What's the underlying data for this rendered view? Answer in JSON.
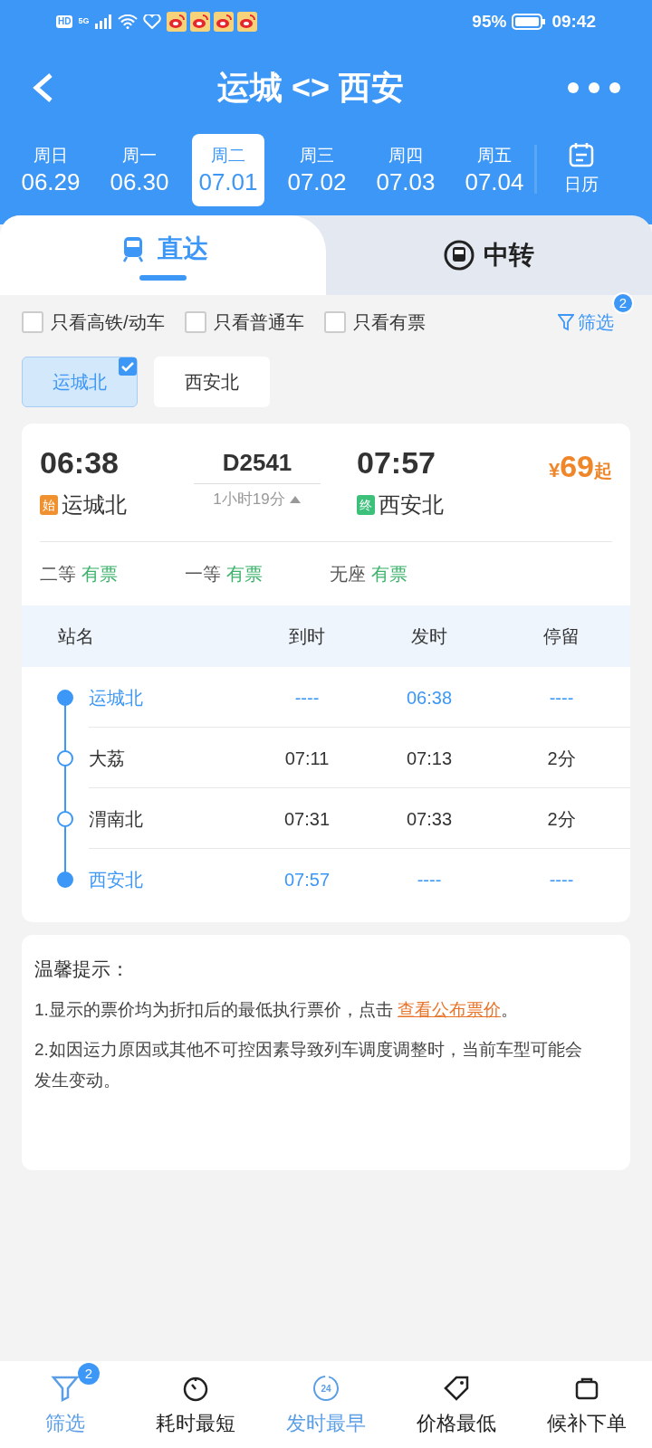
{
  "status_bar": {
    "hd_label": "HD",
    "network": "5G",
    "battery": "95%",
    "time": "09:42"
  },
  "header": {
    "title": "运城 <> 西安"
  },
  "dates": [
    {
      "weekday": "周日",
      "date": "06.29",
      "selected": false
    },
    {
      "weekday": "周一",
      "date": "06.30",
      "selected": false
    },
    {
      "weekday": "周二",
      "date": "07.01",
      "selected": true
    },
    {
      "weekday": "周三",
      "date": "07.02",
      "selected": false
    },
    {
      "weekday": "周四",
      "date": "07.03",
      "selected": false
    },
    {
      "weekday": "周五",
      "date": "07.04",
      "selected": false
    }
  ],
  "calendar_button": "日历",
  "tabs": [
    {
      "label": "直达",
      "selected": true
    },
    {
      "label": "中转",
      "selected": false
    }
  ],
  "filters": [
    {
      "label": "只看高铁/动车",
      "checked": false
    },
    {
      "label": "只看普通车",
      "checked": false
    },
    {
      "label": "只看有票",
      "checked": false
    }
  ],
  "filter_button": {
    "label": "筛选",
    "badge": "2"
  },
  "stations": [
    {
      "label": "运城北",
      "selected": true
    },
    {
      "label": "西安北",
      "selected": false
    }
  ],
  "train": {
    "depart_time": "06:38",
    "depart_tag": "始",
    "depart_station": "运城北",
    "number": "D2541",
    "duration": "1小时19分",
    "arrive_time": "07:57",
    "arrive_tag": "终",
    "arrive_station": "西安北",
    "price_symbol": "¥",
    "price": "69",
    "price_suffix": "起",
    "seats": [
      {
        "class": "二等",
        "availability": "有票"
      },
      {
        "class": "一等",
        "availability": "有票"
      },
      {
        "class": "无座",
        "availability": "有票"
      }
    ],
    "stop_columns": [
      "站名",
      "到时",
      "发时",
      "停留"
    ],
    "stops": [
      {
        "kind": "terminal",
        "name": "运城北",
        "arrive": "----",
        "depart": "06:38",
        "stay": "----"
      },
      {
        "kind": "mid",
        "name": "大荔",
        "arrive": "07:11",
        "depart": "07:13",
        "stay": "2分"
      },
      {
        "kind": "mid",
        "name": "渭南北",
        "arrive": "07:31",
        "depart": "07:33",
        "stay": "2分"
      },
      {
        "kind": "terminal",
        "name": "西安北",
        "arrive": "07:57",
        "depart": "----",
        "stay": "----"
      }
    ]
  },
  "tips": {
    "title": "温馨提示：",
    "items": [
      {
        "text": "1.显示的票价均为折扣后的最低执行票价，点击 ",
        "link": "查看公布票价",
        "after": "。"
      },
      {
        "text": "2.如因运力原因或其他不可控因素导致列车调度调整时，当前车型可能会发生变动。"
      }
    ]
  },
  "bottom_bar": [
    {
      "kind": "filter",
      "label": "筛选",
      "badge": "2",
      "selected": true
    },
    {
      "kind": "timer",
      "label": "耗时最短",
      "selected": false
    },
    {
      "kind": "clock24",
      "label": "发时最早",
      "icon_text": "24",
      "selected": true
    },
    {
      "kind": "tag",
      "label": "价格最低",
      "selected": false
    },
    {
      "kind": "bag",
      "label": "候补下单",
      "selected": false
    }
  ]
}
